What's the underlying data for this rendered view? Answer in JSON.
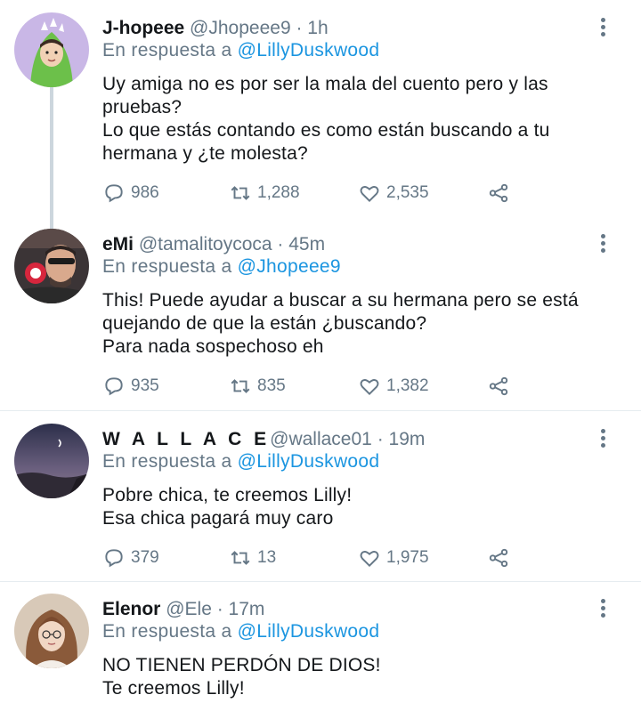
{
  "tweets": [
    {
      "name": "J-hopeee",
      "handle": "@Jhopeee9",
      "time": "· 1h",
      "reply_prefix": "En respuesta a",
      "reply_to": "@LillyDuskwood",
      "text": "Uy amiga no es por ser la mala del cuento pero y las pruebas?\nLo que estás contando es como están buscando a tu hermana y ¿te molesta?",
      "replies": "986",
      "retweets": "1,288",
      "likes": "2,535",
      "avatar_bg": "#c9b7e6"
    },
    {
      "name": "eMi",
      "handle": "@tamalitoycoca",
      "time": "· 45m",
      "reply_prefix": "En respuesta a",
      "reply_to": "@Jhopeee9",
      "text": "This! Puede ayudar a buscar a su hermana pero se está quejando de que la están ¿buscando?\nPara nada sospechoso eh",
      "replies": "935",
      "retweets": "835",
      "likes": "1,382",
      "avatar_bg": "#3b3436"
    },
    {
      "name": "W A L L A C E",
      "handle": "@wallace01",
      "time": "· 19m",
      "reply_prefix": "En respuesta a",
      "reply_to": "@LillyDuskwood",
      "text": "Pobre chica, te creemos Lilly!\nEsa chica pagará muy caro",
      "replies": "379",
      "retweets": "13",
      "likes": "1,975",
      "avatar_bg": "#4b4a66"
    },
    {
      "name": "Elenor",
      "handle": "@Ele",
      "time": "· 17m",
      "reply_prefix": "En respuesta a",
      "reply_to": "@LillyDuskwood",
      "text": "NO TIENEN PERDÓN DE DIOS!\nTe creemos Lilly!",
      "avatar_bg": "#d8c9b8"
    }
  ],
  "colors": {
    "accent": "#1b95e0",
    "muted": "#657786",
    "divider": "#e6ecf0",
    "thread_line": "#ccd6dd"
  },
  "icons": [
    "reply-icon",
    "retweet-icon",
    "like-icon",
    "share-icon",
    "more-options-icon"
  ]
}
